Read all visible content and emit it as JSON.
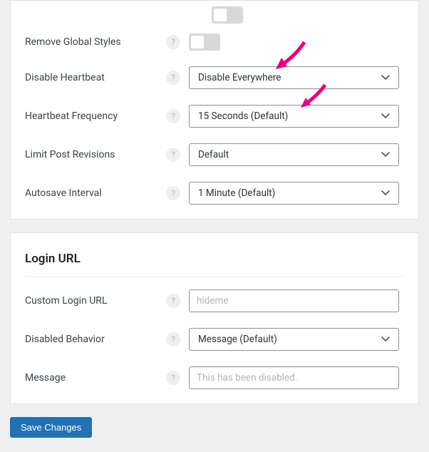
{
  "section1": {
    "rows": {
      "remove_global_styles": {
        "label": "Remove Global Styles",
        "on": false
      },
      "disable_heartbeat": {
        "label": "Disable Heartbeat",
        "value": "Disable Everywhere"
      },
      "heartbeat_frequency": {
        "label": "Heartbeat Frequency",
        "value": "15 Seconds (Default)"
      },
      "limit_post_revisions": {
        "label": "Limit Post Revisions",
        "value": "Default"
      },
      "autosave_interval": {
        "label": "Autosave Interval",
        "value": "1 Minute (Default)"
      }
    }
  },
  "section2": {
    "title": "Login URL",
    "rows": {
      "custom_login_url": {
        "label": "Custom Login URL",
        "placeholder": "hideme",
        "value": ""
      },
      "disabled_behavior": {
        "label": "Disabled Behavior",
        "value": "Message (Default)"
      },
      "message": {
        "label": "Message",
        "placeholder": "This has been disabled.",
        "value": ""
      }
    }
  },
  "actions": {
    "save": "Save Changes"
  },
  "help_glyph": "?"
}
